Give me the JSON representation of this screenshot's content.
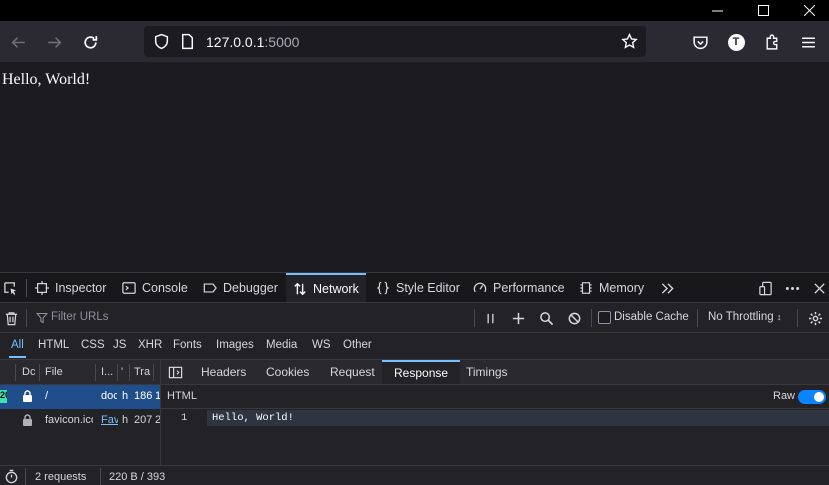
{
  "browser": {
    "url_host": "127.0.0.1",
    "url_port": ":5000",
    "profile_initial": "T"
  },
  "page": {
    "text": "Hello, World!"
  },
  "devtools": {
    "tabs": [
      {
        "label": "Inspector",
        "icon": "inspector-icon"
      },
      {
        "label": "Console",
        "icon": "console-icon"
      },
      {
        "label": "Debugger",
        "icon": "debugger-icon"
      },
      {
        "label": "Network",
        "icon": "network-icon",
        "selected": true
      },
      {
        "label": "Style Editor",
        "icon": "style-editor-icon"
      },
      {
        "label": "Performance",
        "icon": "performance-icon"
      },
      {
        "label": "Memory",
        "icon": "memory-icon"
      }
    ],
    "filter_placeholder": "Filter URLs",
    "disable_cache_label": "Disable Cache",
    "throttling_label": "No Throttling",
    "type_filters": [
      "All",
      "HTML",
      "CSS",
      "JS",
      "XHR",
      "Fonts",
      "Images",
      "Media",
      "WS",
      "Other"
    ],
    "selected_type_filter": "All",
    "columns": [
      "Dc",
      "File",
      "I...",
      "'",
      "Tra",
      ""
    ],
    "requests": [
      {
        "status": "200",
        "domain": "",
        "file": "/",
        "initiator": "doc",
        "type": "h",
        "transferred": "186",
        "size": "1",
        "selected": true
      },
      {
        "status": "",
        "domain": "",
        "file": "favicon.ico",
        "initiator": "Fav",
        "type": "h",
        "transferred": "207",
        "size": "2",
        "selected": false
      }
    ],
    "detail_tabs": [
      "Headers",
      "Cookies",
      "Request",
      "Response",
      "Timings"
    ],
    "selected_detail_tab": "Response",
    "response_format": "HTML",
    "raw_label": "Raw",
    "raw_enabled": true,
    "response_lines": [
      {
        "number": "1",
        "text": "Hello, World!"
      }
    ],
    "status": {
      "requests": "2 requests",
      "transferred": "220 B / 393"
    },
    "accent_color": "#75bfff"
  }
}
